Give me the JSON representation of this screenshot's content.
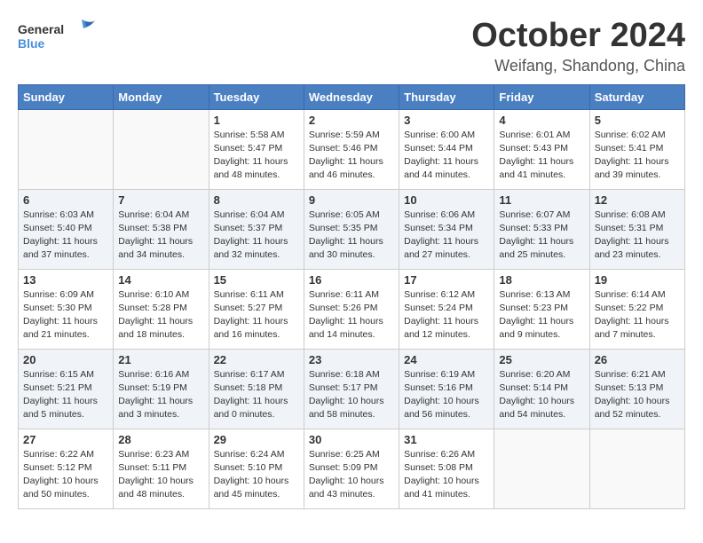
{
  "header": {
    "logo_general": "General",
    "logo_blue": "Blue",
    "month": "October 2024",
    "location": "Weifang, Shandong, China"
  },
  "weekdays": [
    "Sunday",
    "Monday",
    "Tuesday",
    "Wednesday",
    "Thursday",
    "Friday",
    "Saturday"
  ],
  "weeks": [
    [
      null,
      null,
      {
        "day": 1,
        "sunrise": "5:58 AM",
        "sunset": "5:47 PM",
        "daylight": "11 hours and 48 minutes."
      },
      {
        "day": 2,
        "sunrise": "5:59 AM",
        "sunset": "5:46 PM",
        "daylight": "11 hours and 46 minutes."
      },
      {
        "day": 3,
        "sunrise": "6:00 AM",
        "sunset": "5:44 PM",
        "daylight": "11 hours and 44 minutes."
      },
      {
        "day": 4,
        "sunrise": "6:01 AM",
        "sunset": "5:43 PM",
        "daylight": "11 hours and 41 minutes."
      },
      {
        "day": 5,
        "sunrise": "6:02 AM",
        "sunset": "5:41 PM",
        "daylight": "11 hours and 39 minutes."
      }
    ],
    [
      {
        "day": 6,
        "sunrise": "6:03 AM",
        "sunset": "5:40 PM",
        "daylight": "11 hours and 37 minutes."
      },
      {
        "day": 7,
        "sunrise": "6:04 AM",
        "sunset": "5:38 PM",
        "daylight": "11 hours and 34 minutes."
      },
      {
        "day": 8,
        "sunrise": "6:04 AM",
        "sunset": "5:37 PM",
        "daylight": "11 hours and 32 minutes."
      },
      {
        "day": 9,
        "sunrise": "6:05 AM",
        "sunset": "5:35 PM",
        "daylight": "11 hours and 30 minutes."
      },
      {
        "day": 10,
        "sunrise": "6:06 AM",
        "sunset": "5:34 PM",
        "daylight": "11 hours and 27 minutes."
      },
      {
        "day": 11,
        "sunrise": "6:07 AM",
        "sunset": "5:33 PM",
        "daylight": "11 hours and 25 minutes."
      },
      {
        "day": 12,
        "sunrise": "6:08 AM",
        "sunset": "5:31 PM",
        "daylight": "11 hours and 23 minutes."
      }
    ],
    [
      {
        "day": 13,
        "sunrise": "6:09 AM",
        "sunset": "5:30 PM",
        "daylight": "11 hours and 21 minutes."
      },
      {
        "day": 14,
        "sunrise": "6:10 AM",
        "sunset": "5:28 PM",
        "daylight": "11 hours and 18 minutes."
      },
      {
        "day": 15,
        "sunrise": "6:11 AM",
        "sunset": "5:27 PM",
        "daylight": "11 hours and 16 minutes."
      },
      {
        "day": 16,
        "sunrise": "6:11 AM",
        "sunset": "5:26 PM",
        "daylight": "11 hours and 14 minutes."
      },
      {
        "day": 17,
        "sunrise": "6:12 AM",
        "sunset": "5:24 PM",
        "daylight": "11 hours and 12 minutes."
      },
      {
        "day": 18,
        "sunrise": "6:13 AM",
        "sunset": "5:23 PM",
        "daylight": "11 hours and 9 minutes."
      },
      {
        "day": 19,
        "sunrise": "6:14 AM",
        "sunset": "5:22 PM",
        "daylight": "11 hours and 7 minutes."
      }
    ],
    [
      {
        "day": 20,
        "sunrise": "6:15 AM",
        "sunset": "5:21 PM",
        "daylight": "11 hours and 5 minutes."
      },
      {
        "day": 21,
        "sunrise": "6:16 AM",
        "sunset": "5:19 PM",
        "daylight": "11 hours and 3 minutes."
      },
      {
        "day": 22,
        "sunrise": "6:17 AM",
        "sunset": "5:18 PM",
        "daylight": "11 hours and 0 minutes."
      },
      {
        "day": 23,
        "sunrise": "6:18 AM",
        "sunset": "5:17 PM",
        "daylight": "10 hours and 58 minutes."
      },
      {
        "day": 24,
        "sunrise": "6:19 AM",
        "sunset": "5:16 PM",
        "daylight": "10 hours and 56 minutes."
      },
      {
        "day": 25,
        "sunrise": "6:20 AM",
        "sunset": "5:14 PM",
        "daylight": "10 hours and 54 minutes."
      },
      {
        "day": 26,
        "sunrise": "6:21 AM",
        "sunset": "5:13 PM",
        "daylight": "10 hours and 52 minutes."
      }
    ],
    [
      {
        "day": 27,
        "sunrise": "6:22 AM",
        "sunset": "5:12 PM",
        "daylight": "10 hours and 50 minutes."
      },
      {
        "day": 28,
        "sunrise": "6:23 AM",
        "sunset": "5:11 PM",
        "daylight": "10 hours and 48 minutes."
      },
      {
        "day": 29,
        "sunrise": "6:24 AM",
        "sunset": "5:10 PM",
        "daylight": "10 hours and 45 minutes."
      },
      {
        "day": 30,
        "sunrise": "6:25 AM",
        "sunset": "5:09 PM",
        "daylight": "10 hours and 43 minutes."
      },
      {
        "day": 31,
        "sunrise": "6:26 AM",
        "sunset": "5:08 PM",
        "daylight": "10 hours and 41 minutes."
      },
      null,
      null
    ]
  ]
}
